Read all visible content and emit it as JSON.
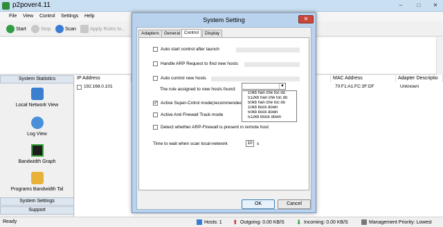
{
  "window": {
    "title": "p2pover4.11",
    "minimize": "–",
    "maximize": "□",
    "close": "✕"
  },
  "menu": [
    "File",
    "View",
    "Control",
    "Settings",
    "Help"
  ],
  "toolbar": {
    "start": "Start",
    "stop": "Stop",
    "scan": "Scan",
    "apply_rules": "Apply Rules to..."
  },
  "sidebar": {
    "system_statistics": "System Statistics",
    "items": [
      {
        "label": "Local Network View",
        "icon": "network-computer-icon"
      },
      {
        "label": "Log View",
        "icon": "log-view-icon"
      },
      {
        "label": "Bandwidth Graph",
        "icon": "bandwidth-graph-icon"
      },
      {
        "label": "Programs Bandwidth Tal",
        "icon": "programs-bandwidth-icon"
      }
    ],
    "system_settings": "System Settings",
    "support": "Support"
  },
  "table": {
    "columns": [
      "IP Address",
      "s",
      "MAC Address",
      "Adapter Descriptio"
    ],
    "rows": [
      {
        "ip": "192.168.0.101",
        "mac": "70:F1:A1:FC:3F:DF",
        "adapter": "Unknown"
      }
    ]
  },
  "status": {
    "ready": "Ready",
    "hosts": "Hosts: 1",
    "outgoing": "Outgoing: 0.00 KB/S",
    "incoming": "Incoming: 0.00 KB/S",
    "priority": "Management Priority: Lowest"
  },
  "dialog": {
    "title": "System Setting",
    "close": "✕",
    "tabs": [
      "Adapters",
      "General",
      "Control",
      "Display"
    ],
    "options": {
      "auto_start": "Auto start control after launch",
      "handle_arp": "Handle ARP Request to find new hosts",
      "auto_control": "Auto control new hosts",
      "rule_label": "The rule assigned to new hosts found:",
      "super_control": "Active Super-Cntrol mode(recommended)",
      "anti_firewall": "Active Anti Firewall Track mode",
      "detect_arp": "Detect whether ARP-Firewall is present in remote host"
    },
    "dropdown_items": [
      "10kb han che toc do",
      "512kb han che toc do",
      "50kb han che toc do",
      "10kb bock down",
      "50kb bock down",
      "512kb block down"
    ],
    "wait_label": "Time to wait when scan local-network",
    "wait_value": "10",
    "wait_unit": "s",
    "ok": "OK",
    "cancel": "Cancel"
  }
}
